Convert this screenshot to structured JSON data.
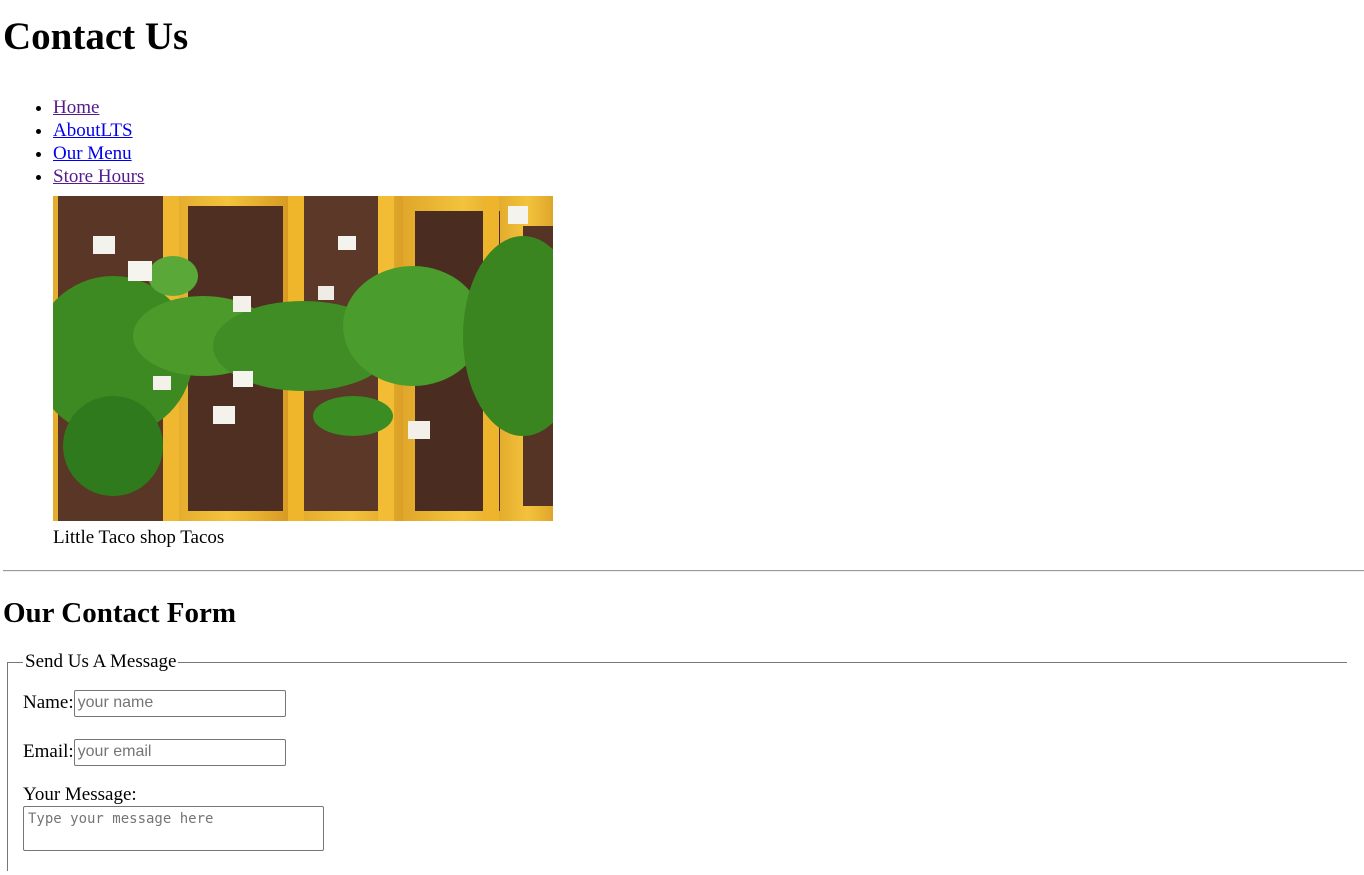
{
  "page": {
    "title": "Contact Us"
  },
  "nav": {
    "items": [
      {
        "label": "Home",
        "visited": true
      },
      {
        "label": "AboutLTS",
        "visited": false
      },
      {
        "label": "Our Menu",
        "visited": false
      },
      {
        "label": "Store Hours",
        "visited": true
      }
    ]
  },
  "hero": {
    "caption": "Little Taco shop Tacos"
  },
  "form_section": {
    "heading": "Our Contact Form",
    "legend": "Send Us A Message",
    "name_label": "Name:",
    "name_placeholder": "your name",
    "email_label": "Email:",
    "email_placeholder": "your email",
    "message_label": "Your Message:",
    "message_placeholder": "Type your message here"
  },
  "colors": {
    "link": "#0000ee",
    "visited_link": "#551a8b"
  }
}
